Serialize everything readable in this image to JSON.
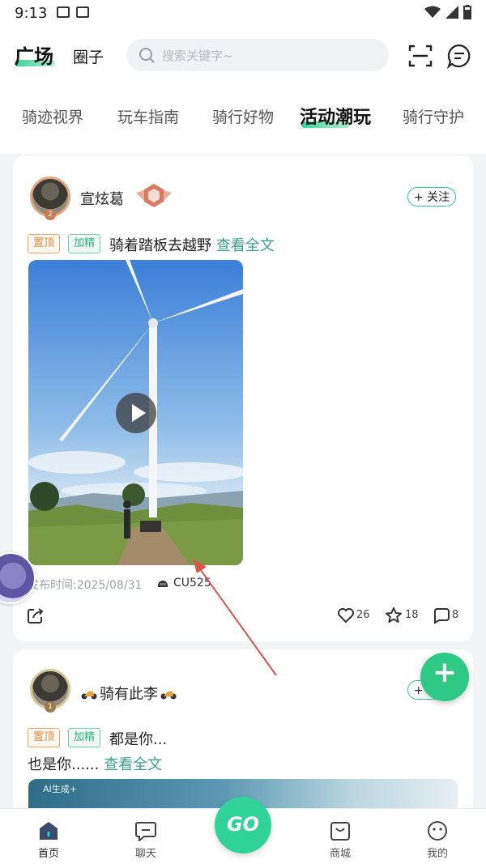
{
  "status": {
    "time": "9:13"
  },
  "header": {
    "tabs": [
      {
        "label": "广场"
      },
      {
        "label": "圈子"
      }
    ],
    "search_placeholder": "搜索关键字~"
  },
  "categories": [
    "骑迹视界",
    "玩车指南",
    "骑行好物",
    "活动潮玩",
    "骑行守护"
  ],
  "posts": [
    {
      "username": "宣炫葛",
      "avatar_level": "2",
      "follow_label": "+ 关注",
      "tag_top": "置顶",
      "tag_elite": "加精",
      "title": "骑着踏板去越野",
      "read_more": "查看全文",
      "publish_time": "发布时间:2025/08/31",
      "vehicle": "CU525",
      "likes": "26",
      "stars": "18",
      "comments": "8"
    },
    {
      "username": "骑有此李",
      "avatar_level": "1",
      "follow_label": "+ 关注",
      "tag_top": "置顶",
      "tag_elite": "加精",
      "title": "都是你...",
      "body": "也是你......",
      "read_more": "查看全文",
      "image_label": "AI生成+"
    }
  ],
  "fab_label": "+",
  "bottom_nav": [
    {
      "label": "首页"
    },
    {
      "label": "聊天"
    },
    {
      "label": "GO"
    },
    {
      "label": "商城"
    },
    {
      "label": "我的"
    }
  ],
  "colors": {
    "accent": "#2fc986",
    "tag_top": "#e8883e",
    "tag_elite": "#2eb07d",
    "link": "#3aa28c",
    "arrow": "#d9534f"
  }
}
